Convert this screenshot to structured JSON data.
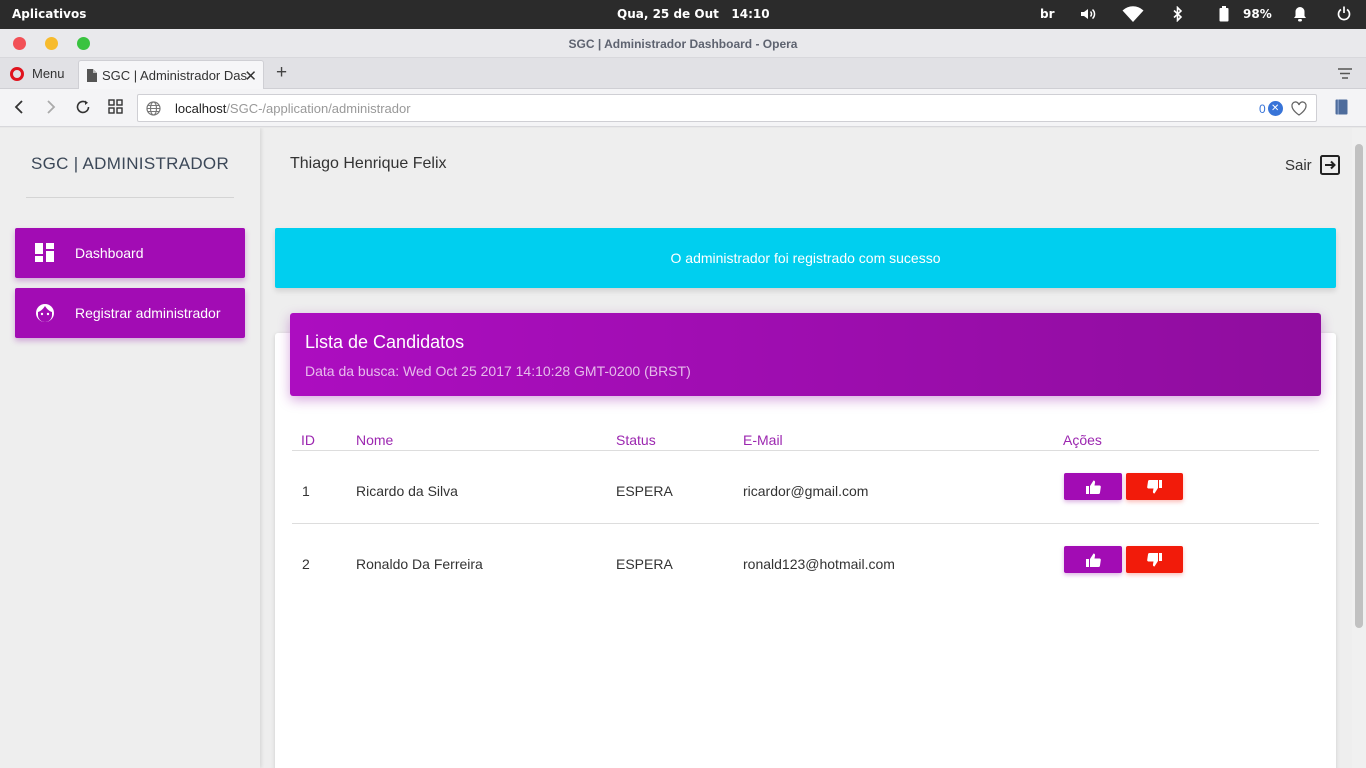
{
  "os": {
    "apps_label": "Aplicativos",
    "clock": "Qua, 25 de Out   14:10",
    "keyboard_layout": "br",
    "battery_percent": "98%"
  },
  "browser": {
    "window_title": "SGC | Administrador Dashboard - Opera",
    "menu_label": "Menu",
    "tab_title": "SGC | Administrador Dashboard",
    "url_host": "localhost",
    "url_path": "/SGC-/application/administrador",
    "blocked_count": "0"
  },
  "sidebar": {
    "brand": "SGC | ADMINISTRADOR",
    "items": [
      {
        "label": "Dashboard",
        "icon": "dashboard-icon"
      },
      {
        "label": "Registrar administrador",
        "icon": "face-icon"
      }
    ]
  },
  "header": {
    "user_name": "Thiago Henrique Felix",
    "logout_label": "Sair"
  },
  "alert": {
    "message": "O administrador foi registrado com sucesso"
  },
  "card": {
    "title": "Lista de Candidatos",
    "subtitle": "Data da busca: Wed Oct 25 2017 14:10:28 GMT-0200 (BRST)",
    "columns": [
      "ID",
      "Nome",
      "Status",
      "E-Mail",
      "Ações"
    ],
    "rows": [
      {
        "id": "1",
        "name": "Ricardo da Silva",
        "status": "ESPERA",
        "email": "ricardor@gmail.com"
      },
      {
        "id": "2",
        "name": "Ronaldo Da Ferreira",
        "status": "ESPERA",
        "email": "ronald123@hotmail.com"
      }
    ]
  },
  "colors": {
    "accent": "#a20cb4",
    "alert_bg": "#00cfef",
    "danger": "#f21b0a"
  }
}
